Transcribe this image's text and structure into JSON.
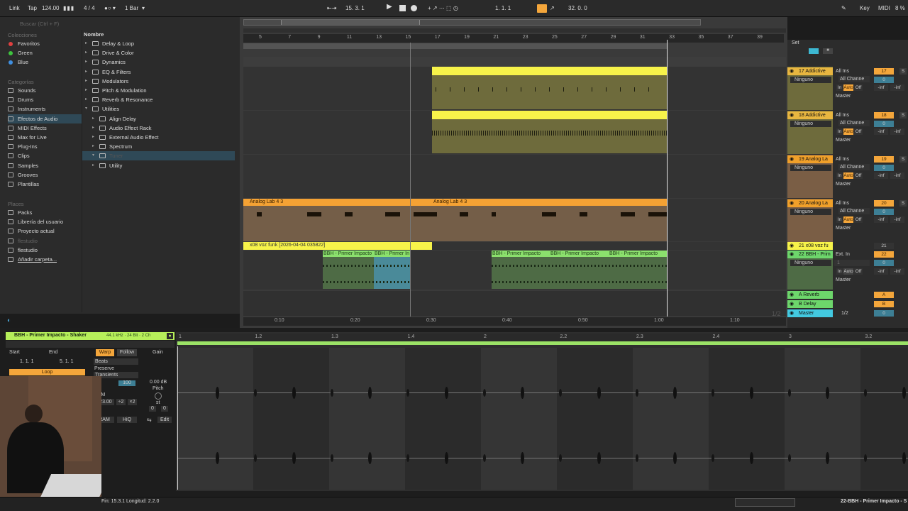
{
  "toolbar": {
    "link": "Link",
    "tap": "Tap",
    "tempo": "124.00",
    "signature": "4 / 4",
    "quantize": "1 Bar",
    "position": "15.   3.   1",
    "loop_start": "1.   1.   1",
    "loop_length": "32.   0.   0",
    "key": "Key",
    "midi": "MIDI",
    "extra": "8 %"
  },
  "browser": {
    "search_placeholder": "Buscar (Ctrl + F)",
    "collections_header": "Colecciones",
    "collections": [
      {
        "label": "Favoritos",
        "color": "#e04040"
      },
      {
        "label": "Green",
        "color": "#3ec43e"
      },
      {
        "label": "Blue",
        "color": "#3f8fe0"
      }
    ],
    "categories_header": "Categorías",
    "categories": [
      "Sounds",
      "Drums",
      "Instruments",
      "Efectos de Audio",
      "MIDI Effects",
      "Max for Live",
      "Plug-Ins",
      "Clips",
      "Samples",
      "Grooves",
      "Plantillas"
    ],
    "places_header": "Places",
    "places": [
      "Packs",
      "Librería del usuario",
      "Proyecto actual",
      "flestudio",
      "flestudio",
      "Añadir carpeta..."
    ],
    "name_header": "Nombre",
    "tree": [
      "Delay & Loop",
      "Drive & Color",
      "Dynamics",
      "EQ & Filters",
      "Modulators",
      "Pitch & Modulation",
      "Reverb & Resonance",
      "Utilities",
      "Align Delay",
      "Audio Effect Rack",
      "External Audio Effect",
      "Spectrum",
      "Tuner",
      "Utility"
    ]
  },
  "ruler": {
    "bars": [
      "5",
      "7",
      "9",
      "11",
      "13",
      "15",
      "17",
      "19",
      "21",
      "23",
      "25",
      "27",
      "29",
      "31",
      "33",
      "35",
      "37",
      "39"
    ],
    "times": [
      "0:10",
      "0:20",
      "0:30",
      "0:40",
      "0:50",
      "1:00",
      "1:10"
    ],
    "fraction": "1/2"
  },
  "clips": {
    "analog_a": "Analog Lab 4 3",
    "analog_b": "Analog Lab 4 3",
    "voz": "x08 voz funk [2026-04-04 035822]",
    "bbh_1": "BBH - Primer Impacto",
    "bbh_2": "BBH - Primer In",
    "bbh_3": "BBH - Primer Impacto",
    "bbh_4": "BBH - Primer Impacto",
    "bbh_5": "BBH - Primer Impacto"
  },
  "mixer": {
    "set_label": "Set",
    "tracks": [
      {
        "name": "17 Addictive",
        "input": "All Ins",
        "channel": "All Channe",
        "monitor": "Ninguno",
        "number": "17",
        "vol": "0",
        "db1": "-inf",
        "db2": "-inf",
        "color": "#e8b640"
      },
      {
        "name": "18 Addictive",
        "input": "All Ins",
        "channel": "All Channe",
        "monitor": "Ninguno",
        "number": "18",
        "vol": "0",
        "db1": "-inf",
        "db2": "-inf",
        "color": "#e8b640"
      },
      {
        "name": "19 Analog La",
        "input": "All Ins",
        "channel": "All Channe",
        "monitor": "Ninguno",
        "number": "19",
        "vol": "0",
        "db1": "-inf",
        "db2": "-inf",
        "color": "#f0a02a"
      },
      {
        "name": "20 Analog La",
        "input": "All Ins",
        "channel": "All Channe",
        "monitor": "Ninguno",
        "number": "20",
        "vol": "0",
        "db1": "-inf",
        "db2": "-inf",
        "color": "#f0a02a"
      }
    ],
    "voz_track": {
      "name": "21 x08 voz fu",
      "number": "21"
    },
    "bbh_track": {
      "name": "22 BBH - Prim",
      "input": "Ext. In",
      "channel": "1",
      "monitor": "Ninguno",
      "number": "22",
      "vol": "0",
      "db1": "-inf",
      "db2": "-inf"
    },
    "master_out": "Master",
    "in": "In",
    "auto": "Auto",
    "off": "Off",
    "returns": [
      {
        "name": "A Reverb",
        "letter": "A"
      },
      {
        "name": "B Delay",
        "letter": "B"
      }
    ],
    "master": {
      "name": "Master",
      "fraction": "1/2",
      "vol": "0"
    }
  },
  "clip_detail": {
    "title": "BBH - Primer Impacto - Shaker",
    "info": "44.1 kHz · 24 Bit · 2 Ch",
    "start_label": "Start",
    "end_label": "End",
    "start": "1.   1.   1",
    "end": "5.   1.   1",
    "loop": "Loop",
    "warp": "Warp",
    "follow": "Follow",
    "gain": "Gain",
    "mode": "Beats",
    "preserve": "Preserve",
    "transients": "Transients",
    "value_100": "100",
    "bpm_label": "BPM",
    "bpm": "123.00",
    "half": "÷2",
    "double": "×2",
    "gain_db": "0.00 dB",
    "pitch": "Pitch",
    "semitones": "st",
    "pitch_val": "0",
    "detune_val": "0",
    "ram": "RAM",
    "hiq": "HiQ",
    "edit": "Edit",
    "ruler": [
      "1",
      "1.2",
      "1.3",
      "1.4",
      "2",
      "2.2",
      "2.3",
      "2.4",
      "3",
      "3.2"
    ]
  },
  "status": {
    "text": "Fin: 15.3.1  Longitud: 2.2.0",
    "right": "22-BBH - Primer Impacto - S"
  },
  "colors": {
    "yellow": "#f7f34a",
    "orange": "#f5a234",
    "green": "#6dd66b",
    "teal": "#4aa7b8",
    "playhead": "#ffffff",
    "clip_green": "#b6ef5a"
  }
}
